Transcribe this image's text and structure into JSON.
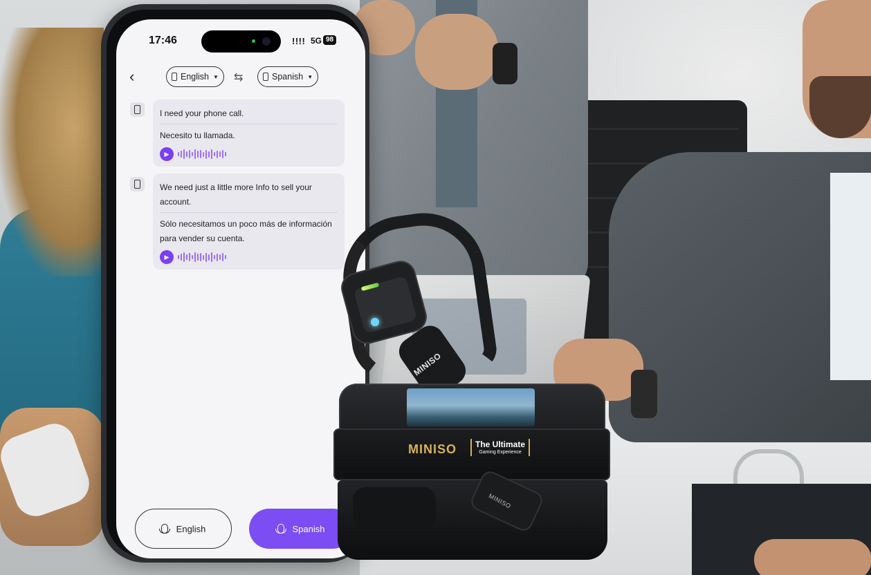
{
  "status_bar": {
    "time": "17:46",
    "signal": "!!!!",
    "network": "5G",
    "battery": "98"
  },
  "header": {
    "source_lang": "English",
    "target_lang": "Spanish"
  },
  "messages": [
    {
      "source": "I need your phone call.",
      "translation": "Necesito tu llamada."
    },
    {
      "source": "We need just a little more Info to sell your account.",
      "translation": "Sólo necesitamos un poco más de información para vender su cuenta."
    }
  ],
  "footer": {
    "left_button": "English",
    "right_button": "Spanish"
  },
  "product": {
    "earbud_logo": "MINISO",
    "case_brand": "MINISO",
    "case_tag_line1": "The Ultimate",
    "case_tag_line2": "Gaming Experience",
    "inner_bud_logo": "MINISO"
  },
  "colors": {
    "accent": "#7b4df2",
    "play": "#7b3ff2",
    "wave": "#9b6ef3",
    "brand_gold": "#d8b15c"
  },
  "icons": [
    "back-arrow-icon",
    "phone-icon",
    "swap-icon",
    "caret-down-icon",
    "play-icon",
    "microphone-icon"
  ]
}
